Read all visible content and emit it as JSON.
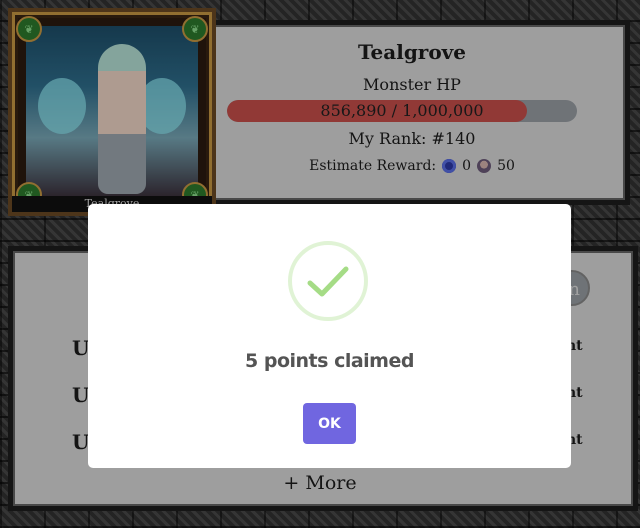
{
  "boss": {
    "card_name": "Tealgrove",
    "name": "Tealgrove",
    "hp_label": "Monster HP",
    "hp_text": "856,890 / 1,000,000",
    "hp_fraction": 0.857,
    "rank_label": "My Rank: #140",
    "reward_label": "Estimate Reward:",
    "reward_token_1": "0",
    "reward_token_2": "50"
  },
  "list": {
    "row_prefix": "U",
    "row_suffix": "nt",
    "button_partial": "n",
    "more_label": "+ More"
  },
  "modal": {
    "title": "5 points claimed",
    "ok_label": "OK",
    "icon_color": "#a5dc86",
    "button_color": "#7066e0"
  },
  "colors": {
    "hp_fill": "#c9504c",
    "hp_track": "#9aa0a6",
    "panel": "#dcdcdc"
  }
}
